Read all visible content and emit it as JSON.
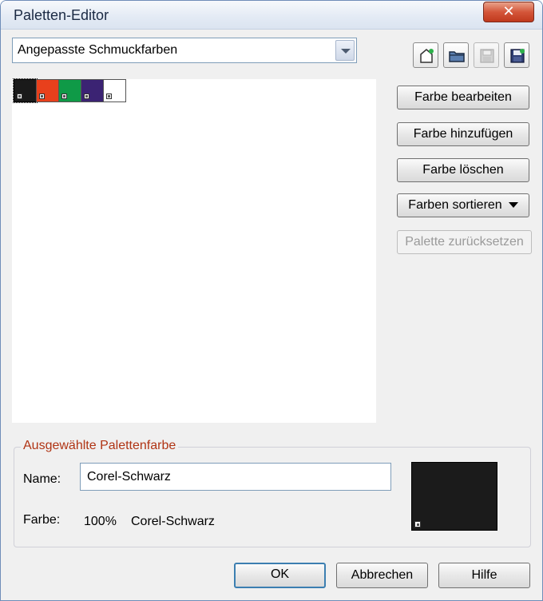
{
  "window": {
    "title": "Paletten-Editor",
    "close_label": "✕"
  },
  "palette_select": {
    "value": "Angepasste Schmuckfarben"
  },
  "toolbar": {
    "icons": [
      "new-palette-icon",
      "open-palette-icon",
      "save-palette-icon",
      "save-as-palette-icon"
    ]
  },
  "swatches": [
    {
      "name": "black",
      "color": "#1a1a1a",
      "selected": true
    },
    {
      "name": "red-orange",
      "color": "#e8401c"
    },
    {
      "name": "green",
      "color": "#0f9a47"
    },
    {
      "name": "indigo",
      "color": "#3b2373"
    },
    {
      "name": "white",
      "color": "#ffffff"
    }
  ],
  "actions": {
    "edit": "Farbe bearbeiten",
    "add": "Farbe hinzufügen",
    "delete": "Farbe löschen",
    "sort": "Farben sortieren",
    "reset": "Palette zurücksetzen"
  },
  "selected_color": {
    "group_title": "Ausgewählte Palettenfarbe",
    "name_label": "Name:",
    "name_value": "Corel-Schwarz",
    "color_label": "Farbe:",
    "color_percent": "100%",
    "color_name": "Corel-Schwarz",
    "preview_color": "#1b1b1b"
  },
  "dialog_buttons": {
    "ok": "OK",
    "cancel": "Abbrechen",
    "help": "Hilfe"
  }
}
